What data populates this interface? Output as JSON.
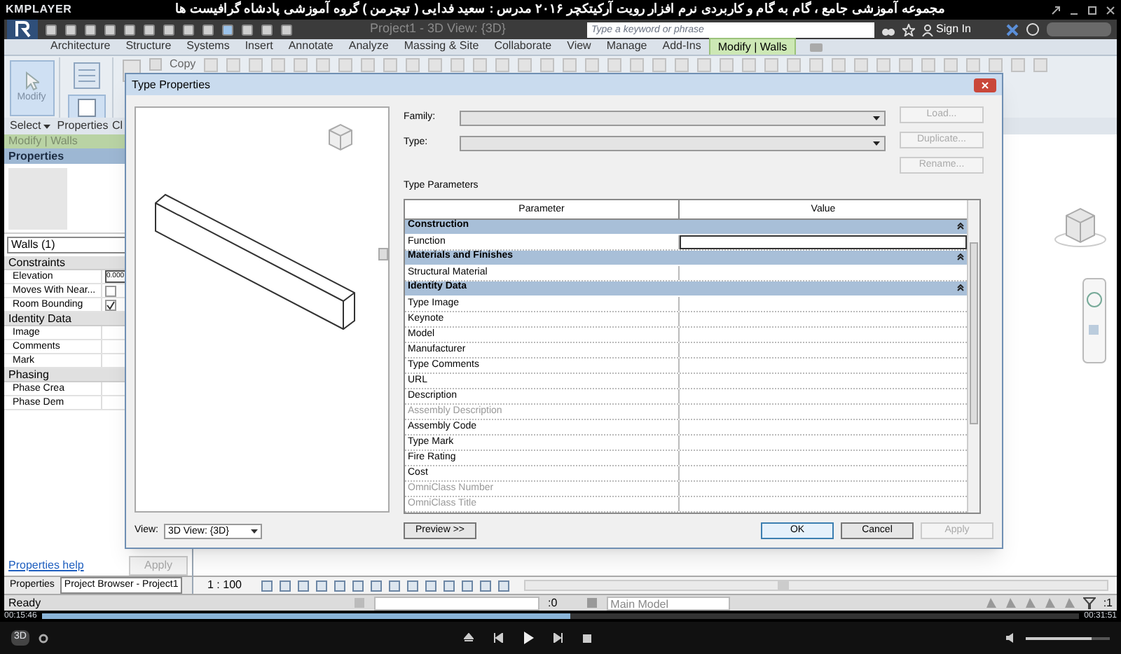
{
  "player": {
    "app": "KMPLAYER",
    "title": "مجموعه آموزشی جامع ، گام به گام و کاربردی نرم افزار رویت آرکیتکچر ۲۰۱۶  مدرس : سعید فدایی ( تیچرمن ) گروه آموزشی پادشاه گرافیست ها",
    "elapsed": "00:15:46",
    "total": "00:31:51",
    "seek": {
      "level": 0.51
    },
    "volume": {
      "level": 0.78
    },
    "mode_label": "3D"
  },
  "revit": {
    "window_title": "Project1 - 3D View: {3D}",
    "search": {
      "placeholder": "Type a keyword or phrase"
    },
    "sign_in": "Sign In",
    "tabs": [
      {
        "label": "Architecture",
        "selected": false
      },
      {
        "label": "Structure",
        "selected": false
      },
      {
        "label": "Systems",
        "selected": false
      },
      {
        "label": "Insert",
        "selected": false
      },
      {
        "label": "Annotate",
        "selected": false
      },
      {
        "label": "Analyze",
        "selected": false
      },
      {
        "label": "Massing & Site",
        "selected": false
      },
      {
        "label": "Collaborate",
        "selected": false
      },
      {
        "label": "View",
        "selected": false
      },
      {
        "label": "Manage",
        "selected": false
      },
      {
        "label": "Add-Ins",
        "selected": false
      },
      {
        "label": "Modify | Walls",
        "selected": true
      }
    ],
    "ribbon": {
      "modify_button": "Modify",
      "copy_label": "Copy",
      "panels": [
        "Select",
        "Properties",
        "Cl"
      ]
    },
    "context_label": "Modify | Walls"
  },
  "properties": {
    "title": "Properties",
    "type_selector": "Walls (1)",
    "groups": [
      {
        "name": "Constraints",
        "rows": [
          {
            "label": "Elevation",
            "kind": "text",
            "value": "0.000"
          },
          {
            "label": "Moves With Near...",
            "kind": "checkbox",
            "checked": false
          },
          {
            "label": "Room Bounding",
            "kind": "checkbox",
            "checked": true
          }
        ]
      },
      {
        "name": "Identity Data",
        "rows": [
          {
            "label": "Image",
            "kind": "text"
          },
          {
            "label": "Comments",
            "kind": "text"
          },
          {
            "label": "Mark",
            "kind": "text"
          }
        ]
      },
      {
        "name": "Phasing",
        "rows": [
          {
            "label": "Phase Crea",
            "kind": "text"
          },
          {
            "label": "Phase Dem",
            "kind": "text"
          }
        ]
      }
    ],
    "help_link": "Properties help",
    "apply": "Apply"
  },
  "bottom_tabs": [
    {
      "label": "Properties",
      "selected": false
    },
    {
      "label": "Project Browser - Project1",
      "selected": true
    }
  ],
  "view_bar": {
    "scale": "1 : 100"
  },
  "status_bar": {
    "text": "Ready",
    "selection_count": ":0",
    "workset": "Main Model",
    "filter_count": ":1"
  },
  "dialog": {
    "title": "Type Properties",
    "family_label": "Family:",
    "type_label": "Type:",
    "side_buttons": [
      {
        "label": "Load...",
        "disabled": true
      },
      {
        "label": "Duplicate...",
        "disabled": true
      },
      {
        "label": "Rename...",
        "disabled": true
      }
    ],
    "section_label": "Type Parameters",
    "columns": [
      "Parameter",
      "Value"
    ],
    "groups": [
      {
        "name": "Construction",
        "rows": [
          {
            "label": "Function",
            "disabled": false,
            "active": true
          }
        ]
      },
      {
        "name": "Materials and Finishes",
        "rows": [
          {
            "label": "Structural Material",
            "disabled": false,
            "active": false
          }
        ]
      },
      {
        "name": "Identity Data",
        "rows": [
          {
            "label": "Type Image",
            "disabled": false,
            "active": false
          },
          {
            "label": "Keynote",
            "disabled": false,
            "active": false
          },
          {
            "label": "Model",
            "disabled": false,
            "active": false
          },
          {
            "label": "Manufacturer",
            "disabled": false,
            "active": false
          },
          {
            "label": "Type Comments",
            "disabled": false,
            "active": false
          },
          {
            "label": "URL",
            "disabled": false,
            "active": false
          },
          {
            "label": "Description",
            "disabled": false,
            "active": false
          },
          {
            "label": "Assembly Description",
            "disabled": true,
            "active": false
          },
          {
            "label": "Assembly Code",
            "disabled": false,
            "active": false
          },
          {
            "label": "Type Mark",
            "disabled": false,
            "active": false
          },
          {
            "label": "Fire Rating",
            "disabled": false,
            "active": false
          },
          {
            "label": "Cost",
            "disabled": false,
            "active": false
          },
          {
            "label": "OmniClass Number",
            "disabled": true,
            "active": false
          },
          {
            "label": "OmniClass Title",
            "disabled": true,
            "active": false
          }
        ]
      }
    ],
    "view_label": "View:",
    "view_value": "3D View: {3D}",
    "preview_button": "Preview >>",
    "footer_buttons": [
      {
        "label": "OK",
        "disabled": false
      },
      {
        "label": "Cancel",
        "disabled": false
      },
      {
        "label": "Apply",
        "disabled": true
      }
    ]
  }
}
